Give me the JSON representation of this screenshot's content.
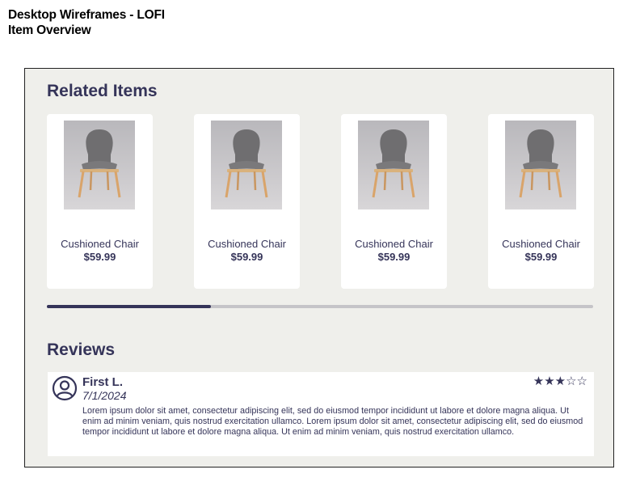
{
  "doc": {
    "title_line1": "Desktop Wireframes - LOFI",
    "title_line2": "Item Overview"
  },
  "related": {
    "title": "Related Items",
    "items": [
      {
        "name": "Cushioned Chair",
        "price": "$59.99"
      },
      {
        "name": "Cushioned Chair",
        "price": "$59.99"
      },
      {
        "name": "Cushioned Chair",
        "price": "$59.99"
      },
      {
        "name": "Cushioned Chair",
        "price": "$59.99"
      }
    ],
    "scroll_progress": 0.3
  },
  "reviews": {
    "title": "Reviews",
    "items": [
      {
        "author": "First L.",
        "date": "7/1/2024",
        "rating": 3,
        "rating_max": 5,
        "body": "Lorem ipsum dolor sit amet, consectetur adipiscing elit, sed do eiusmod tempor incididunt ut labore et dolore magna aliqua. Ut enim ad minim veniam, quis nostrud exercitation ullamco. Lorem ipsum dolor sit amet, consectetur adipiscing elit, sed do eiusmod tempor incididunt ut labore et dolore magna aliqua. Ut enim ad minim veniam, quis nostrud exercitation ullamco."
      }
    ]
  },
  "colors": {
    "accent": "#353459",
    "frame_background": "#efefeb",
    "card_background": "#ffffff",
    "scroll_track": "#c5c4c8"
  },
  "icons": {
    "avatar": "user-circle-icon",
    "star_filled": "star-filled-icon",
    "star_empty": "star-outline-icon"
  }
}
